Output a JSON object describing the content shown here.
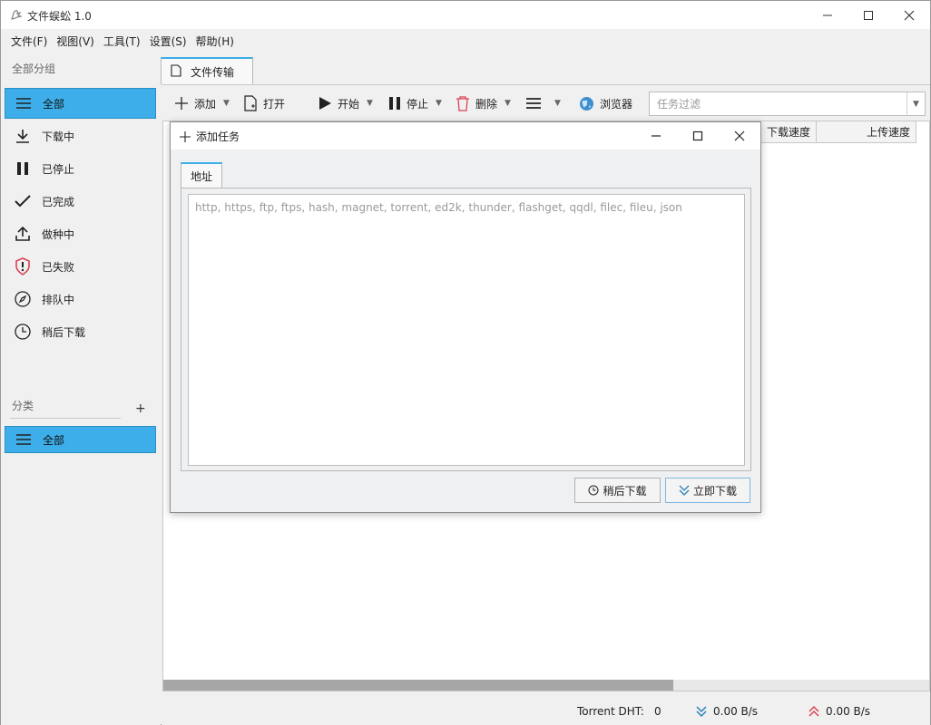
{
  "window": {
    "title": "文件蜈蚣 1.0"
  },
  "menu": [
    "文件(F)",
    "视图(V)",
    "工具(T)",
    "设置(S)",
    "帮助(H)"
  ],
  "sidebar": {
    "group_heading": "全部分组",
    "items": [
      {
        "label": "全部",
        "icon": "list-icon",
        "active": true
      },
      {
        "label": "下载中",
        "icon": "download-icon",
        "active": false
      },
      {
        "label": "已停止",
        "icon": "pause-icon",
        "active": false
      },
      {
        "label": "已完成",
        "icon": "check-icon",
        "active": false
      },
      {
        "label": "做种中",
        "icon": "upload-icon",
        "active": false
      },
      {
        "label": "已失败",
        "icon": "shield-alert-icon",
        "active": false
      },
      {
        "label": "排队中",
        "icon": "compass-icon",
        "active": false
      },
      {
        "label": "稍后下载",
        "icon": "clock-icon",
        "active": false
      }
    ],
    "category_heading": "分类",
    "category_add": "+",
    "category_items": [
      {
        "label": "全部",
        "icon": "list-icon",
        "active": true
      }
    ]
  },
  "main": {
    "tab_label": "文件传输",
    "toolbar": {
      "add": "添加",
      "open": "打开",
      "start": "开始",
      "stop": "停止",
      "delete": "删除",
      "browser": "浏览器",
      "filter_placeholder": "任务过滤"
    },
    "columns": {
      "download_speed": "下载速度",
      "upload_speed": "上传速度"
    },
    "status": {
      "dht_label": "Torrent DHT:",
      "dht_value": "0",
      "download_rate": "0.00 B/s",
      "upload_rate": "0.00 B/s"
    }
  },
  "dialog": {
    "title": "添加任务",
    "tab": "地址",
    "url_placeholder": "http, https, ftp, ftps, hash, magnet, torrent, ed2k, thunder, flashget, qqdl, filec, fileu, json",
    "later_button": "稍后下载",
    "now_button": "立即下载"
  },
  "colors": {
    "accent": "#3daee9",
    "delete_red": "#da4453",
    "upload_red": "#da4453",
    "download_blue": "#2980b9"
  }
}
